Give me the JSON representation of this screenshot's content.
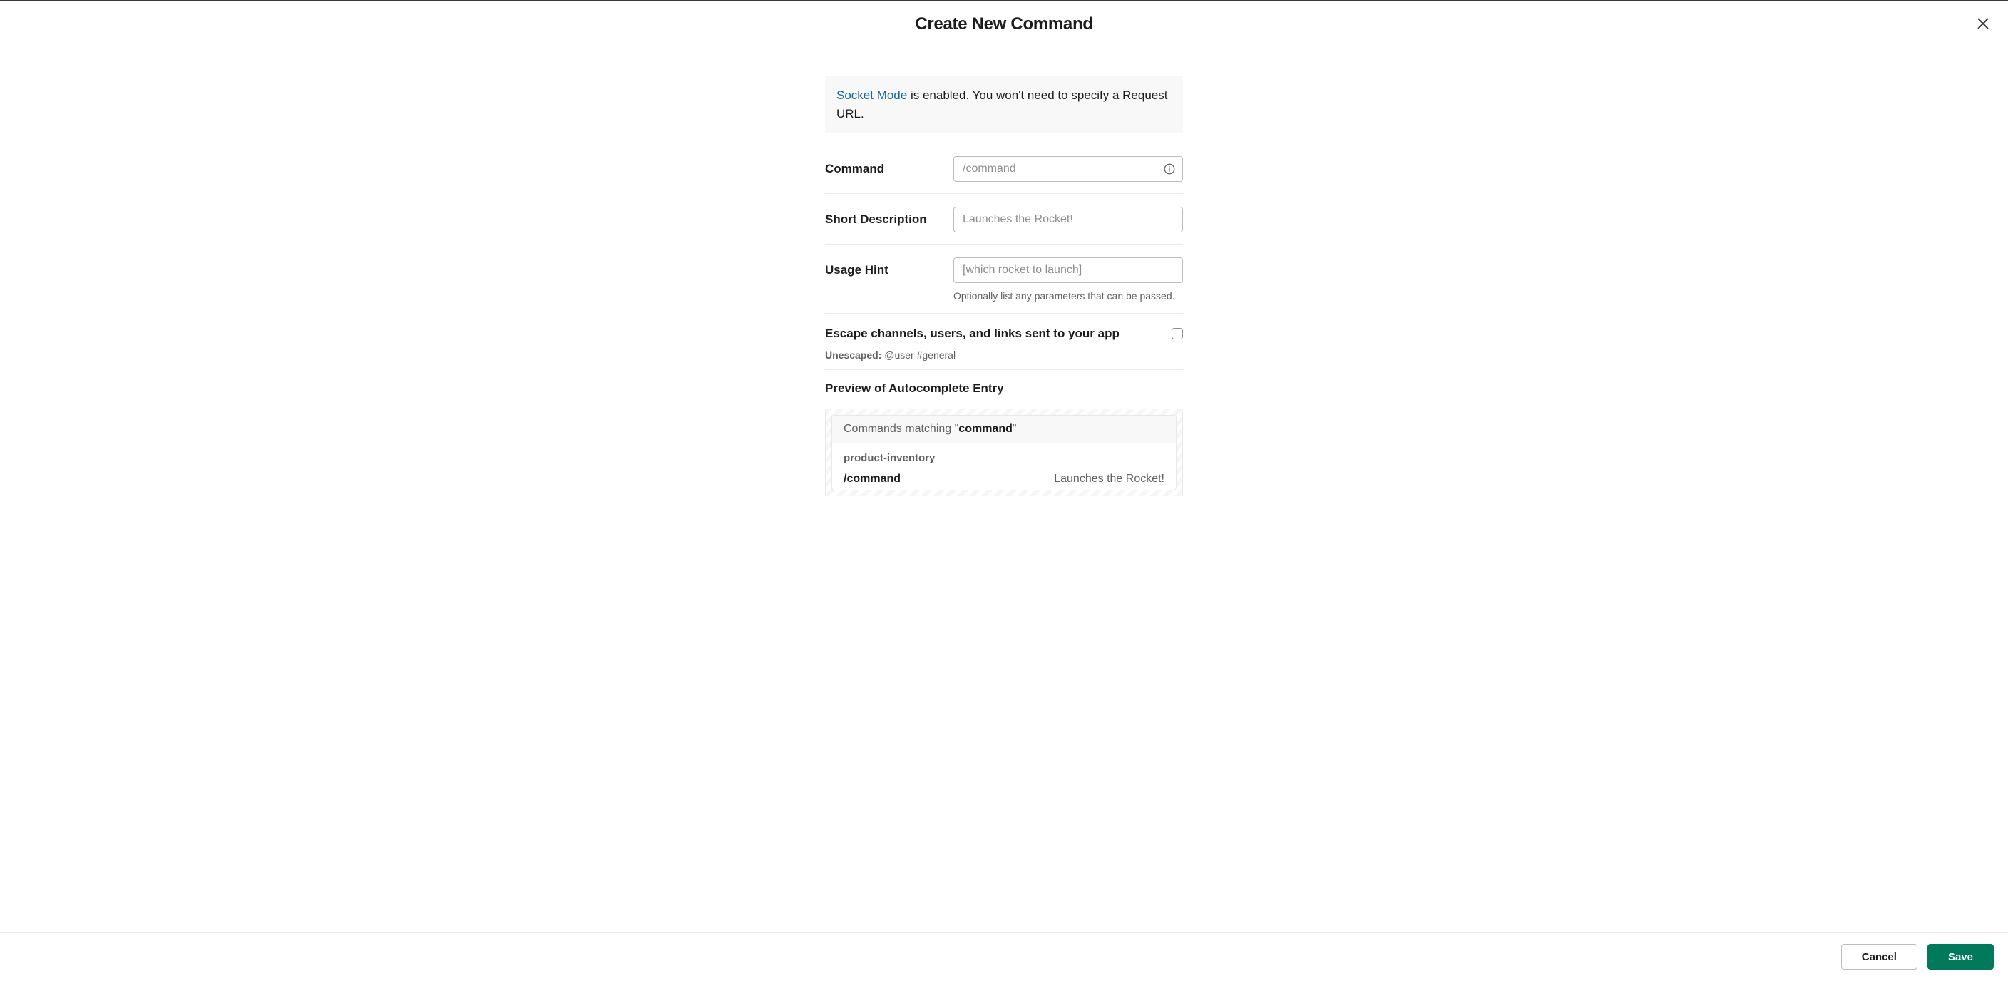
{
  "header": {
    "title": "Create New Command"
  },
  "notice": {
    "link_text": "Socket Mode",
    "rest_text": " is enabled. You won't need to specify a Request URL."
  },
  "fields": {
    "command": {
      "label": "Command",
      "placeholder": "/command",
      "value": ""
    },
    "short_description": {
      "label": "Short Description",
      "placeholder": "Launches the Rocket!",
      "value": ""
    },
    "usage_hint": {
      "label": "Usage Hint",
      "placeholder": "[which rocket to launch]",
      "value": "",
      "help": "Optionally list any parameters that can be passed."
    }
  },
  "escape": {
    "title": "Escape channels, users, and links sent to your app",
    "sub_label": "Unescaped:",
    "sub_value": "@user #general",
    "checked": false
  },
  "preview": {
    "title": "Preview of Autocomplete Entry",
    "head_prefix": "Commands matching \"",
    "head_match": "command",
    "head_suffix": "\"",
    "group_label": "product-inventory",
    "item_command": "/command",
    "item_desc": "Launches the Rocket!"
  },
  "footer": {
    "cancel": "Cancel",
    "save": "Save"
  }
}
